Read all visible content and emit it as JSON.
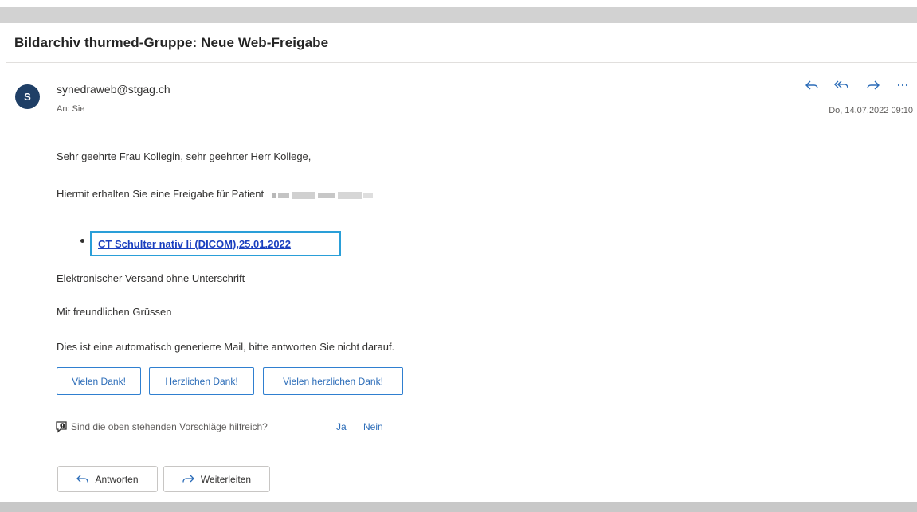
{
  "email": {
    "subject": "Bildarchiv thurmed-Gruppe: Neue Web-Freigabe",
    "avatar_initial": "S",
    "sender": "synedraweb@stgag.ch",
    "recipient_label": "An:",
    "recipient": "Sie",
    "date": "Do, 14.07.2022 09:10",
    "actions": [
      "reply-icon",
      "reply-all-icon",
      "forward-icon",
      "more-icon"
    ],
    "body": {
      "greeting": "Sehr geehrte Frau Kollegin, sehr geehrter Herr Kollege,",
      "intro": "Hiermit erhalten Sie eine Freigabe für Patient",
      "link": "CT Schulter nativ li (DICOM),25.01.2022",
      "line_no_signature": "Elektronischer Versand ohne Unterschrift",
      "closing": "Mit freundlichen Grüssen",
      "auto_note": "Dies ist eine automatisch generierte Mail, bitte antworten Sie nicht darauf."
    },
    "suggestions": [
      "Vielen Dank!",
      "Herzlichen Dank!",
      "Vielen herzlichen Dank!"
    ],
    "feedback": {
      "question": "Sind die oben stehenden Vorschläge hilfreich?",
      "yes": "Ja",
      "no": "Nein"
    },
    "buttons": {
      "reply": "Antworten",
      "forward": "Weiterleiten"
    }
  },
  "colors": {
    "avatar": "#1f3f66",
    "link": "#1a3fbf",
    "link_highlight": "#2a9fd8",
    "accent": "#2b6cb8"
  }
}
